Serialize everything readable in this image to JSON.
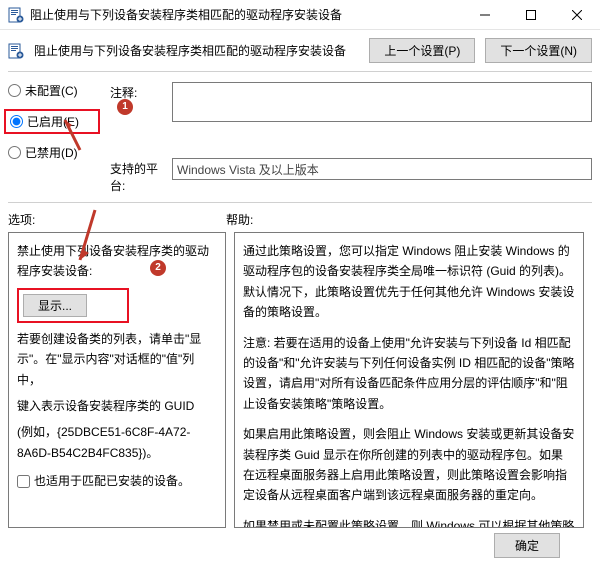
{
  "window": {
    "title": "阻止使用与下列设备安装程序类相匹配的驱动程序安装设备",
    "controls": {
      "min": "—",
      "max": "□",
      "close": "✕"
    }
  },
  "toolbar": {
    "policy_title": "阻止使用与下列设备安装程序类相匹配的驱动程序安装设备",
    "prev": "上一个设置(P)",
    "next": "下一个设置(N)"
  },
  "radios": {
    "not_configured": "未配置(C)",
    "enabled": "已启用(E)",
    "disabled": "已禁用(D)"
  },
  "meta": {
    "comment_label": "注释:",
    "platform_label": "支持的平台:",
    "platform_value": "Windows Vista 及以上版本"
  },
  "labels": {
    "options": "选项:",
    "help": "帮助:"
  },
  "options_pane": {
    "heading": "禁止使用下列设备安装程序类的驱动程序安装设备:",
    "show_button": "显示...",
    "hint1": "若要创建设备类的列表，请单击\"显示\"。在\"显示内容\"对话框的\"值\"列中，",
    "hint2": "键入表示设备安装程序类的 GUID",
    "hint3": "(例如，{25DBCE51-6C8F-4A72-8A6D-B54C2B4FC835})。",
    "checkbox": "也适用于匹配已安装的设备。"
  },
  "help_pane": {
    "p1": "通过此策略设置，您可以指定 Windows 阻止安装 Windows 的驱动程序包的设备安装程序类全局唯一标识符 (Guid 的列表)。默认情况下，此策略设置优先于任何其他允许 Windows 安装设备的策略设置。",
    "p2": "注意: 若要在适用的设备上使用\"允许安装与下列设备 Id 相匹配的设备\"和\"允许安装与下列任何设备实例 ID 相匹配的设备\"策略设置，请启用\"对所有设备匹配条件应用分层的评估顺序\"和\"阻止设备安装策略\"策略设置。",
    "p3": "如果启用此策略设置，则会阻止 Windows 安装或更新其设备安装程序类 Guid 显示在你所创建的列表中的驱动程序包。如果在远程桌面服务器上启用此策略设置，则此策略设置会影响指定设备从远程桌面客户端到该远程桌面服务器的重定向。",
    "p4": "如果禁用或未配置此策略设置，则 Windows 可以根据其他策略设置允许或阻止安装和更新设备。"
  },
  "footer": {
    "ok": "确定"
  },
  "markers": {
    "m1": "1",
    "m2": "2"
  }
}
